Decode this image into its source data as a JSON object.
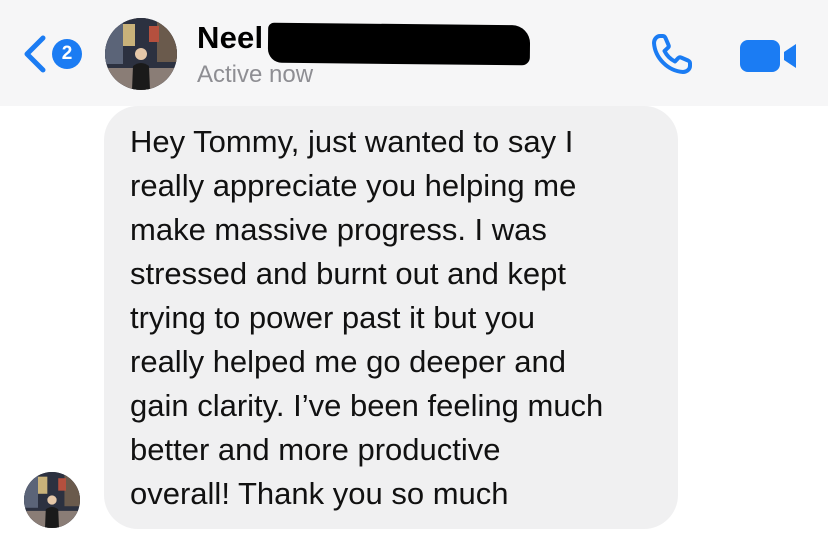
{
  "header": {
    "unread_count": "2",
    "contact_name": "Neel",
    "presence": "Active now",
    "back_icon": "chevron-left-icon",
    "call_icon": "phone-icon",
    "video_icon": "video-camera-icon",
    "accent_color": "#1b7cf3"
  },
  "message": {
    "lines": [
      "Hey Tommy, just wanted to say I",
      "really appreciate you helping me",
      "make massive progress. I was",
      "stressed and burnt out and kept",
      "trying to power past it but you",
      "really helped me go deeper and",
      "gain clarity. I’ve been feeling much",
      "better and more productive",
      "overall! Thank you so much"
    ],
    "bubble_color": "#f0f0f1"
  }
}
